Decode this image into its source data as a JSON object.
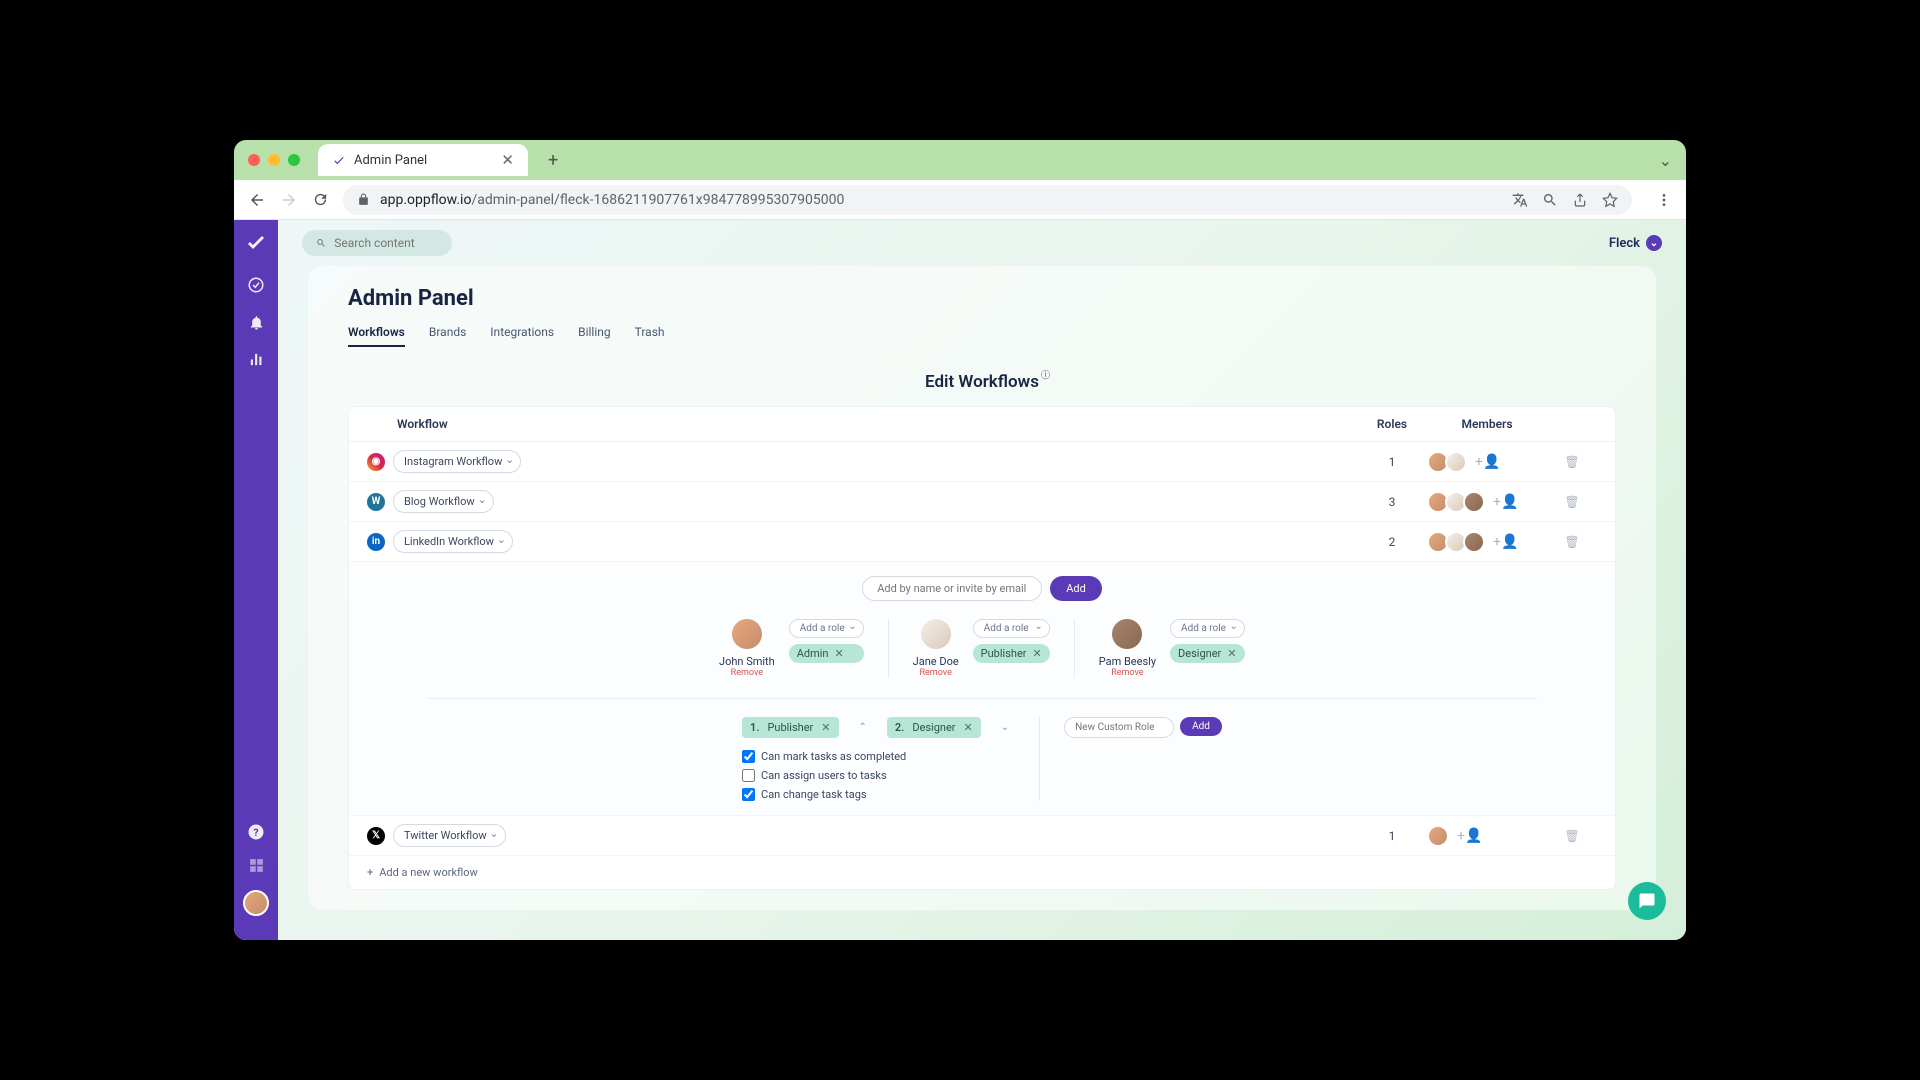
{
  "browser": {
    "tab_title": "Admin Panel",
    "url_host": "app.oppflow.io",
    "url_path": "/admin-panel/fleck-1686211907761x984778995307905000"
  },
  "search": {
    "placeholder": "Search content"
  },
  "org": {
    "name": "Fleck"
  },
  "page": {
    "title": "Admin Panel"
  },
  "tabs": {
    "workflows": "Workflows",
    "brands": "Brands",
    "integrations": "Integrations",
    "billing": "Billing",
    "trash": "Trash"
  },
  "section": {
    "title": "Edit Workflows"
  },
  "columns": {
    "workflow": "Workflow",
    "roles": "Roles",
    "members": "Members"
  },
  "workflows": [
    {
      "name": "Instagram Workflow",
      "roles": "1"
    },
    {
      "name": "Blog Workflow",
      "roles": "3"
    },
    {
      "name": "LinkedIn Workflow",
      "roles": "2"
    },
    {
      "name": "Twitter Workflow",
      "roles": "1"
    }
  ],
  "invite": {
    "placeholder": "Add by name or invite by email",
    "button": "Add"
  },
  "role_controls": {
    "add_role": "Add a role",
    "remove": "Remove"
  },
  "members": [
    {
      "name": "John Smith",
      "role": "Admin"
    },
    {
      "name": "Jane Doe",
      "role": "Publisher"
    },
    {
      "name": "Pam Beesly",
      "role": "Designer"
    }
  ],
  "perm_roles": [
    {
      "num": "1.",
      "name": "Publisher"
    },
    {
      "num": "2.",
      "name": "Designer"
    }
  ],
  "permissions": {
    "completed": "Can mark tasks as completed",
    "assign": "Can assign users to tasks",
    "tags": "Can change task tags"
  },
  "custom_role": {
    "placeholder": "New Custom Role",
    "button": "Add"
  },
  "add_workflow": "Add a new workflow"
}
